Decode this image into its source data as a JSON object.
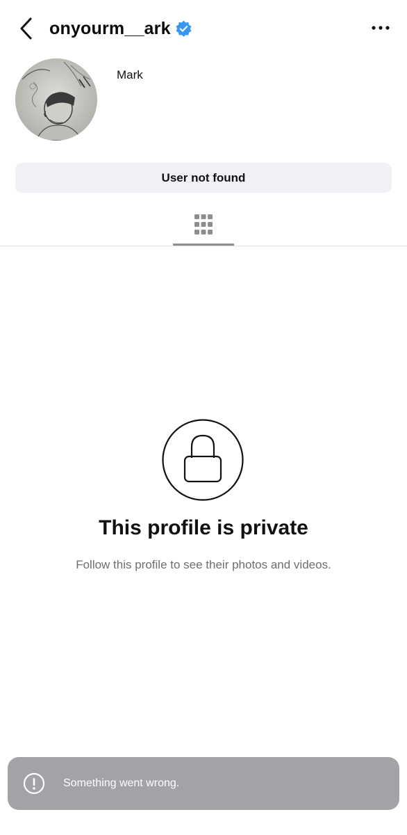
{
  "header": {
    "username": "onyourm__ark",
    "verified": true,
    "back_icon": "chevron-left-icon",
    "more_icon": "more-horizontal-icon",
    "verified_color": "#3897f0"
  },
  "profile": {
    "display_name": "Mark",
    "avatar_description_icon": "avatar",
    "status_button_label": "User not found"
  },
  "tabs": {
    "active": "grid",
    "grid_icon": "grid-icon"
  },
  "private_notice": {
    "icon": "lock-icon",
    "title": "This profile is private",
    "subtitle": "Follow this profile to see their photos and videos."
  },
  "toast": {
    "icon": "exclamation-circle-icon",
    "message": "Something went wrong.",
    "background": "#a1a3a6"
  }
}
